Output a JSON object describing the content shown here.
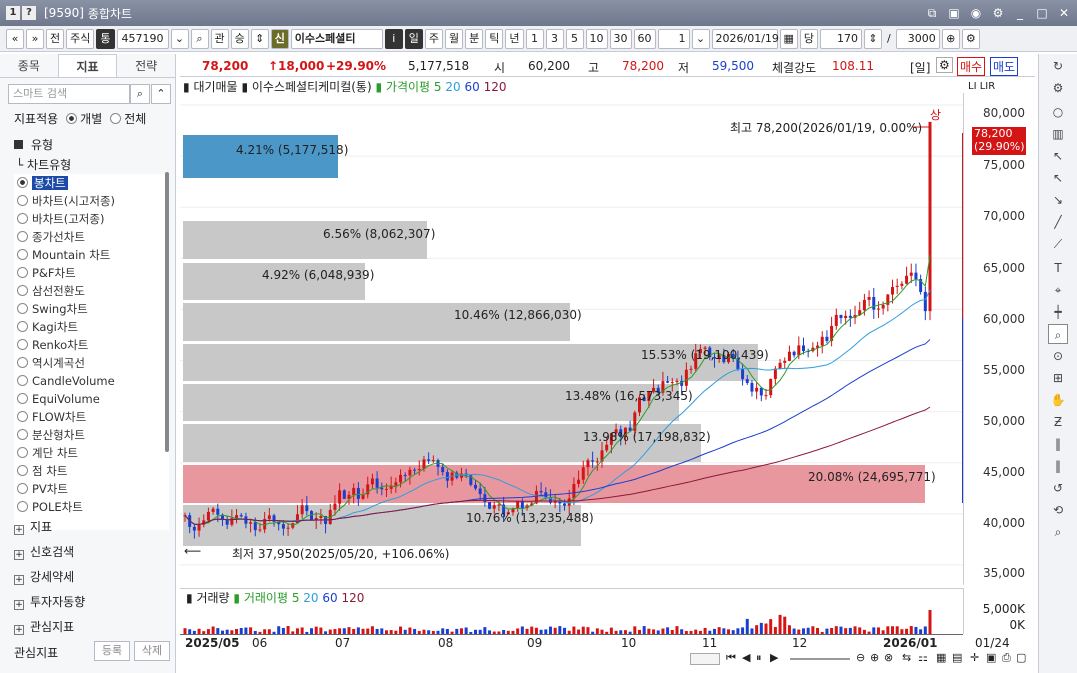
{
  "window": {
    "code": "[9590]",
    "title": "종합차트"
  },
  "toolbar": {
    "prev": "«",
    "next": "»",
    "jeon": "전",
    "stock_type": "주식",
    "tong": "통",
    "code": "457190",
    "gwan": "관",
    "seung": "승",
    "shin": "신",
    "name": "이수스페셜티",
    "info": "i",
    "periods": [
      "일",
      "주",
      "월",
      "분",
      "틱",
      "년"
    ],
    "nums": [
      "1",
      "3",
      "5",
      "10",
      "30",
      "60"
    ],
    "step": "1",
    "date": "2026/01/19",
    "dang": "당",
    "count1": "170",
    "slash": "/",
    "count2": "3000"
  },
  "left": {
    "tabs": [
      "종목",
      "지표",
      "전략"
    ],
    "active_tab": "지표",
    "search_placeholder": "스마트 검색",
    "apply_label": "지표적용",
    "radio1": "개별",
    "radio2": "전체",
    "section": "유형",
    "subsection": "차트유형",
    "chart_types": [
      "봉차트",
      "바차트(시고저종)",
      "바차트(고저종)",
      "종가선차트",
      "Mountain 차트",
      "P&F차트",
      "삼선전환도",
      "Swing차트",
      "Kagi차트",
      "Renko차트",
      "역시계곡선",
      "CandleVolume",
      "EquiVolume",
      "FLOW차트",
      "분산형차트",
      "계단 차트",
      "점 차트",
      "PV차트",
      "POLE차트"
    ],
    "tree": [
      "지표",
      "신호검색",
      "강세약세",
      "투자자동향",
      "관심지표"
    ],
    "footer": {
      "label": "관심지표",
      "register": "등록",
      "delete": "삭제"
    }
  },
  "pricebar": {
    "price": "78,200",
    "change": "↑18,000",
    "pct": "+29.90%",
    "volume": "5,177,518",
    "open_label": "시",
    "open": "60,200",
    "high_label": "고",
    "high": "78,200",
    "low_label": "저",
    "low": "59,500",
    "strength_label": "체결강도",
    "strength": "108.11",
    "period": "[일]",
    "buy": "매수",
    "sell": "매도"
  },
  "legend": {
    "a": "대기매물",
    "b": "이수스페셜티케미컬(통)",
    "c": "가격이평",
    "p5": "5",
    "p20": "20",
    "p60": "60",
    "p120": "120"
  },
  "vlegend": {
    "a": "거래량",
    "c": "거래이평",
    "p5": "5",
    "p20": "20",
    "p60": "60",
    "p120": "120"
  },
  "vp": [
    {
      "label": "4.21% (5,177,518)"
    },
    {
      "label": "6.56% (8,062,307)"
    },
    {
      "label": "4.92% (6,048,939)"
    },
    {
      "label": "10.46% (12,866,030)"
    },
    {
      "label": "15.53% (19,100,439)"
    },
    {
      "label": "13.48% (16,573,345)"
    },
    {
      "label": "13.98% (17,198,832)"
    },
    {
      "label": "20.08% (24,695,771)"
    },
    {
      "label": "10.76% (13,235,488)"
    }
  ],
  "annotations": {
    "high": "최고 78,200(2026/01/19, 0.00%)",
    "low": "최저 37,950(2025/05/20, +106.06%)",
    "sang": "상"
  },
  "yaxis": {
    "ticks": [
      "80,000",
      "75,000",
      "70,000",
      "65,000",
      "60,000",
      "55,000",
      "50,000",
      "45,000",
      "40,000",
      "35,000"
    ],
    "last": "78,200",
    "last_pct": "(29.90%)"
  },
  "vaxis": {
    "ticks": [
      "5,000K",
      "0K"
    ]
  },
  "xaxis": {
    "labels": [
      "2025/05",
      "06",
      "07",
      "08",
      "09",
      "10",
      "11",
      "12",
      "2026/01"
    ],
    "end": "01/24"
  },
  "colors": {
    "up": "#d41515",
    "down": "#1a3fd0",
    "ma5": "#2a9d2a",
    "ma20": "#2d9ee0",
    "ma60": "#1a3fd0",
    "ma120": "#8b1a3a"
  }
}
